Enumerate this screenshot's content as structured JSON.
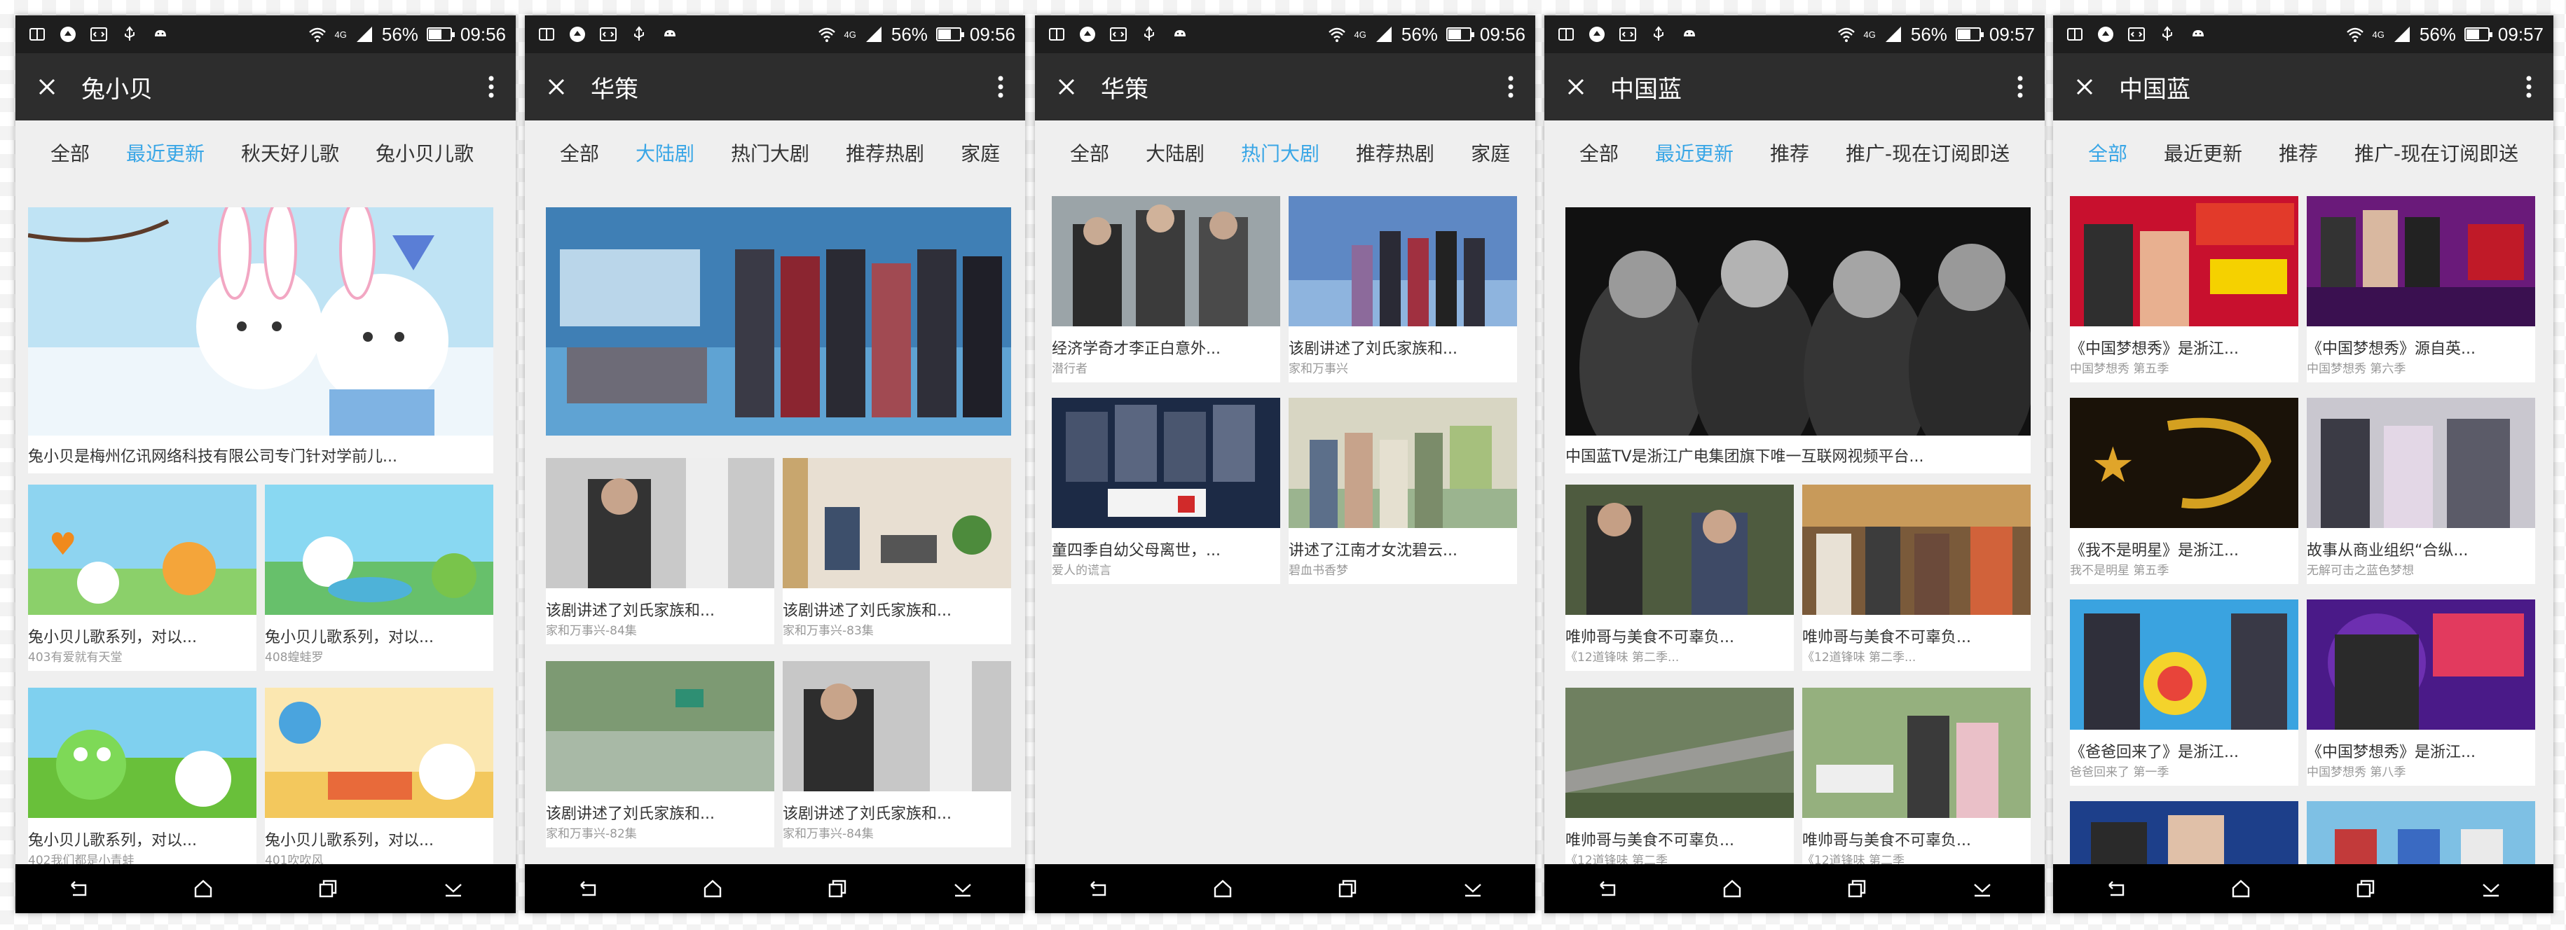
{
  "status": {
    "battery": "56%",
    "network": "4G",
    "signal_sub": "4G"
  },
  "screens": [
    {
      "time": "09:56",
      "title": "兔小贝",
      "tabs": [
        "全部",
        "最近更新",
        "秋天好儿歌",
        "兔小贝儿歌"
      ],
      "active_tab": 1,
      "banner": {
        "title": "兔小贝是梅州亿讯网络科技有限公司专门针对学前儿...",
        "sub": ""
      },
      "items": [
        {
          "title": "兔小贝儿歌系列，对以...",
          "sub": "403有爱就有天堂"
        },
        {
          "title": "兔小贝儿歌系列，对以...",
          "sub": "408蝗蛙罗"
        },
        {
          "title": "兔小贝儿歌系列，对以...",
          "sub": "402我们都是小青蛙"
        },
        {
          "title": "兔小贝儿歌系列，对以...",
          "sub": "401吹吹风"
        }
      ]
    },
    {
      "time": "09:56",
      "title": "华策",
      "tabs": [
        "全部",
        "大陆剧",
        "热门大剧",
        "推荐热剧",
        "家庭"
      ],
      "active_tab": 1,
      "banner": {
        "title": "",
        "sub": ""
      },
      "items": [
        {
          "title": "该剧讲述了刘氏家族和...",
          "sub": "家和万事兴-84集"
        },
        {
          "title": "该剧讲述了刘氏家族和...",
          "sub": "家和万事兴-83集"
        },
        {
          "title": "该剧讲述了刘氏家族和...",
          "sub": "家和万事兴-82集"
        },
        {
          "title": "该剧讲述了刘氏家族和...",
          "sub": "家和万事兴-84集"
        }
      ]
    },
    {
      "time": "09:56",
      "title": "华策",
      "tabs": [
        "全部",
        "大陆剧",
        "热门大剧",
        "推荐热剧",
        "家庭"
      ],
      "active_tab": 2,
      "banner": null,
      "items": [
        {
          "title": "经济学奇才李正白意外...",
          "sub": "潜行者"
        },
        {
          "title": "该剧讲述了刘氏家族和...",
          "sub": "家和万事兴"
        },
        {
          "title": "童四季自幼父母离世，...",
          "sub": "爱人的谎言"
        },
        {
          "title": "讲述了江南才女沈碧云...",
          "sub": "碧血书香梦"
        }
      ]
    },
    {
      "time": "09:57",
      "title": "中国蓝",
      "tabs": [
        "全部",
        "最近更新",
        "推荐",
        "推广-现在订阅即送"
      ],
      "active_tab": 1,
      "banner": {
        "title": "中国蓝TV是浙江广电集团旗下唯一互联网视频平台...",
        "sub": ""
      },
      "items": [
        {
          "title": "唯帅哥与美食不可辜负...",
          "sub": "《12道锋味 第二季..."
        },
        {
          "title": "唯帅哥与美食不可辜负...",
          "sub": "《12道锋味 第二季..."
        },
        {
          "title": "唯帅哥与美食不可辜负...",
          "sub": "《12道锋味 第二季"
        },
        {
          "title": "唯帅哥与美食不可辜负...",
          "sub": "《12道锋味 第二季"
        }
      ]
    },
    {
      "time": "09:57",
      "title": "中国蓝",
      "tabs": [
        "全部",
        "最近更新",
        "推荐",
        "推广-现在订阅即送"
      ],
      "active_tab": 0,
      "banner": null,
      "items": [
        {
          "title": "《中国梦想秀》是浙江...",
          "sub": "中国梦想秀 第五季"
        },
        {
          "title": "《中国梦想秀》源自英...",
          "sub": "中国梦想秀 第六季"
        },
        {
          "title": "《我不是明星》是浙江...",
          "sub": "我不是明星 第五季"
        },
        {
          "title": "故事从商业组织“合纵...",
          "sub": "无解可击之蓝色梦想"
        },
        {
          "title": "《爸爸回来了》是浙江...",
          "sub": "爸爸回来了 第一季"
        },
        {
          "title": "《中国梦想秀》是浙江...",
          "sub": "中国梦想秀 第八季"
        }
      ]
    }
  ],
  "colors": {
    "accent": "#39a6e6",
    "appbar": "#2d2d2d",
    "statusbar": "#1e1e1e",
    "tabbar": "#efefef"
  }
}
